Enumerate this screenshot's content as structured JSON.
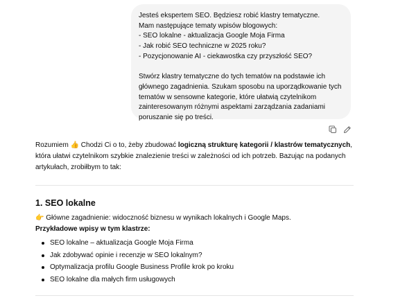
{
  "user_message": {
    "paragraphs": [
      "Jesteś ekspertem SEO. Będziesz robić klastry tematyczne.\nMam następujące tematy wpisów blogowych:\n- SEO lokalne - aktualizacja Google Moja Firma\n- Jak robić SEO techniczne w 2025 roku?\n- Pozycjonowanie AI - ciekawostka czy przyszłość SEO?",
      "Stwórz klastry tematyczne do tych tematów na podstawie ich głównego zagadnienia. Szukam sposobu na uporządkowanie tych tematów w sensowne kategorie, które ułatwią czytelnikom zainteresowanym różnymi aspektami zarządzania zadaniami poruszanie się po treści."
    ]
  },
  "message_actions": {
    "copy_icon": "copy-icon",
    "edit_icon": "pencil-icon"
  },
  "assistant": {
    "intro_part1": "Rozumiem 👍 Chodzi Ci o to, żeby zbudować ",
    "intro_bold": "logiczną strukturę kategorii / klastrów tematycznych",
    "intro_part2": ", która ułatwi czytelnikom szybkie znalezienie treści w zależności od ich potrzeb. Bazując na podanych artykułach, zrobiłbym to tak:",
    "cluster1": {
      "heading": "1. SEO lokalne",
      "main_topic": "👉 Główne zagadnienie: widoczność biznesu w wynikach lokalnych i Google Maps.",
      "examples_title": "Przykładowe wpisy w tym klastrze:",
      "posts": [
        "SEO lokalne – aktualizacja Google Moja Firma",
        "Jak zdobywać opinie i recenzje w SEO lokalnym?",
        "Optymalizacja profilu Google Business Profile krok po kroku",
        "SEO lokalne dla małych firm usługowych"
      ]
    }
  }
}
